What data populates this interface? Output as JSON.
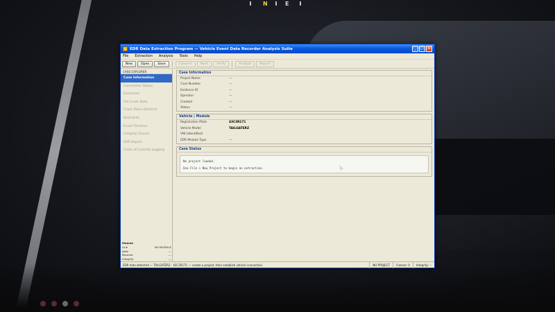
{
  "hud": {
    "compass_n": "N",
    "compass_e": "E"
  },
  "window": {
    "title": "EDR Data Extraction Program — Vehicle Event Data Recorder Analysis Suite",
    "controls": {
      "minimize": "_",
      "maximize": "□",
      "close": "×"
    }
  },
  "menu": [
    "File",
    "Extraction",
    "Analysis",
    "Tools",
    "Help"
  ],
  "toolbar": {
    "buttons": [
      {
        "label": "New",
        "enabled": true
      },
      {
        "label": "Open",
        "enabled": true
      },
      {
        "label": "Save",
        "enabled": true
      }
    ],
    "disabled": [
      "Connect",
      "Read",
      "Verify",
      "Analyze",
      "Report"
    ]
  },
  "sidebar": {
    "header": "CASE EXPLORER",
    "items": [
      {
        "label": "Case Information",
        "active": true
      },
      {
        "label": "Connection Status",
        "active": false
      },
      {
        "label": "Extraction",
        "active": false
      },
      {
        "label": "Pre-Crash Data",
        "active": false
      },
      {
        "label": "Crash Pulse (Delta-V)",
        "active": false
      },
      {
        "label": "Restraints",
        "active": false
      },
      {
        "label": "Event Timeline",
        "active": false
      },
      {
        "label": "Integrity Checks",
        "active": false
      },
      {
        "label": "EDR Report",
        "active": false
      },
      {
        "label": "Chain of Custody Logging",
        "active": false
      }
    ],
    "status": {
      "title": "Module",
      "rows": [
        {
          "k": "Link",
          "v": "NO MODULE"
        },
        {
          "k": "Addr",
          "v": "---"
        },
        {
          "k": "Records",
          "v": "---"
        },
        {
          "k": "Integrity",
          "v": "---"
        }
      ]
    }
  },
  "case_info": {
    "title": "Case Information",
    "fields": [
      {
        "k": "Project Name",
        "v": "---"
      },
      {
        "k": "Case Number",
        "v": "---"
      },
      {
        "k": "Evidence ID",
        "v": "---"
      },
      {
        "k": "Operator",
        "v": "---"
      },
      {
        "k": "Created",
        "v": "---"
      },
      {
        "k": "Status",
        "v": "---"
      }
    ]
  },
  "vehicle": {
    "title": "Vehicle | Module",
    "fields": [
      {
        "k": "Registration Plate",
        "v": "43C3R171",
        "strong": true
      },
      {
        "k": "Vehicle Model",
        "v": "TAILGATERZ",
        "strong": true
      },
      {
        "k": "VIN (Identified)",
        "v": "",
        "strong": false
      },
      {
        "k": "EDR Module Type",
        "v": "---",
        "strong": false
      }
    ]
  },
  "case_status": {
    "title": "Case Status",
    "lines": [
      "No project loaded.",
      "Use File > New Project to begin an extraction."
    ]
  },
  "statusbar": {
    "message": "EDR data detected — TAILGATERZ · 43C3R171 — create a project, then establish vehicle connection.",
    "cells": [
      "NO PROJECT",
      "Frames: 0",
      "Integrity: --"
    ]
  }
}
